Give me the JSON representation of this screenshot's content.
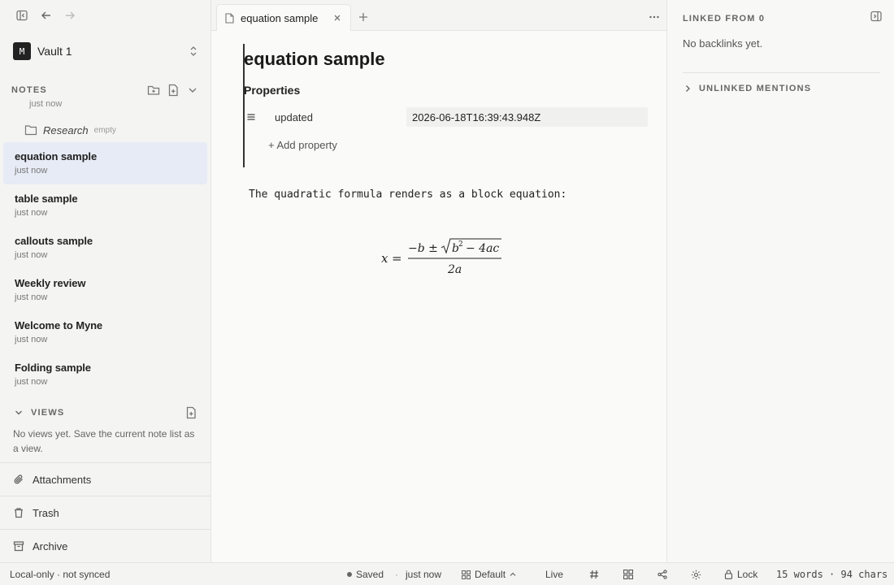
{
  "sidebar": {
    "vault": {
      "badge": "M",
      "name": "Vault 1"
    },
    "notes_label": "NOTES",
    "partial_meta": "just now",
    "folder": {
      "name": "Research",
      "status": "empty"
    },
    "notes": [
      {
        "title": "equation sample",
        "meta": "just now"
      },
      {
        "title": "table sample",
        "meta": "just now"
      },
      {
        "title": "callouts sample",
        "meta": "just now"
      },
      {
        "title": "Weekly review",
        "meta": "just now"
      },
      {
        "title": "Welcome to Myne",
        "meta": "just now"
      },
      {
        "title": "Folding sample",
        "meta": "just now"
      }
    ],
    "views_label": "VIEWS",
    "views_empty": "No views yet. Save the current note list as a view.",
    "bottom": {
      "attachments": "Attachments",
      "trash": "Trash",
      "archive": "Archive"
    }
  },
  "editor": {
    "tab_title": "equation sample",
    "doc_title": "equation sample",
    "properties_heading": "Properties",
    "property": {
      "key": "updated",
      "value": "2026-06-18T16:39:43.948Z"
    },
    "add_property": "+ Add property",
    "paragraph": "The quadratic formula renders as a block equation:",
    "equation": {
      "lhs": "x",
      "eq": "=",
      "numerator_prefix": "−b ±",
      "radicand_base": "b",
      "radicand_exp": "2",
      "radicand_rest": "− 4ac",
      "denominator": "2a"
    }
  },
  "right_panel": {
    "linked_from": "LINKED FROM 0",
    "no_backlinks": "No backlinks yet.",
    "unlinked_mentions": "UNLINKED MENTIONS"
  },
  "status": {
    "sync": "Local-only · not synced",
    "saved": "Saved",
    "sep": "·",
    "saved_time": "just now",
    "layout": "Default",
    "mode": "Live",
    "lock": "Lock",
    "counts": "15 words · 94 chars"
  },
  "colors": {
    "active_note_bg": "#e7ebf5",
    "text": "#222222",
    "muted": "#777777"
  }
}
